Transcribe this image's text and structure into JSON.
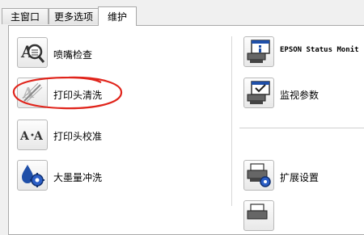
{
  "tabs": [
    {
      "label": "主窗口"
    },
    {
      "label": "更多选项"
    },
    {
      "label": "维护"
    }
  ],
  "left": {
    "items": [
      {
        "label": "喷嘴检查",
        "icon": "nozzle-check-icon"
      },
      {
        "label": "打印头清洗",
        "icon": "head-cleaning-icon"
      },
      {
        "label": "打印头校准",
        "icon": "head-alignment-icon"
      },
      {
        "label": "大墨量冲洗",
        "icon": "power-ink-flushing-icon"
      }
    ]
  },
  "right": {
    "items": [
      {
        "label": "EPSON Status Monit",
        "icon": "status-monitor-icon"
      },
      {
        "label": "监视参数",
        "icon": "monitoring-preferences-icon"
      },
      {
        "label": "扩展设置",
        "icon": "extended-settings-icon"
      },
      {
        "label": "",
        "icon": "print-queue-icon"
      }
    ]
  },
  "colors": {
    "annotation": "#e0241b",
    "accent": "#1f4fa8"
  }
}
